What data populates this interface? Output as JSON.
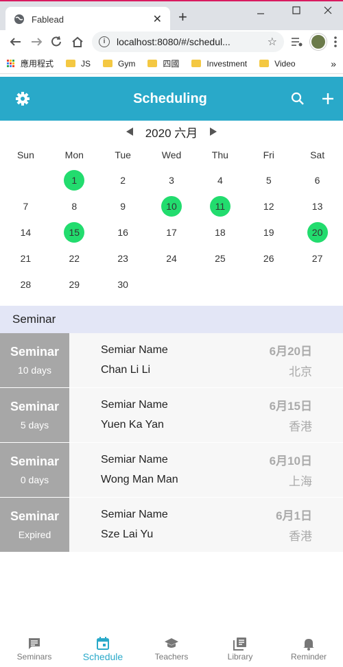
{
  "browser": {
    "tab_title": "Fablead",
    "tab_close": "✕",
    "new_tab": "+",
    "url": "localhost:8080/#/schedul...",
    "bookmarks": [
      "應用程式",
      "JS",
      "Gym",
      "四國",
      "Investment",
      "Video"
    ],
    "bookmarks_more": "»"
  },
  "appbar": {
    "title": "Scheduling",
    "settings_icon": "⚙",
    "search_icon": "⚲",
    "add_icon": "+"
  },
  "calendar": {
    "title": "2020 六月",
    "weekdays": [
      "Sun",
      "Mon",
      "Tue",
      "Wed",
      "Thu",
      "Fri",
      "Sat"
    ],
    "weeks": [
      [
        "",
        "1",
        "2",
        "3",
        "4",
        "5",
        "6"
      ],
      [
        "7",
        "8",
        "9",
        "10",
        "11",
        "12",
        "13"
      ],
      [
        "14",
        "15",
        "16",
        "17",
        "18",
        "19",
        "20"
      ],
      [
        "21",
        "22",
        "23",
        "24",
        "25",
        "26",
        "27"
      ],
      [
        "28",
        "29",
        "30",
        "",
        "",
        "",
        ""
      ]
    ],
    "marked_days": [
      "1",
      "10",
      "11",
      "15",
      "20"
    ],
    "marked_color": "#22dc6e"
  },
  "section": {
    "title": "Seminar"
  },
  "seminars": [
    {
      "badge": "Seminar",
      "days": "10 days",
      "name": "Semiar Name",
      "person": "Chan Li Li",
      "date": "6月20日",
      "place": "北京"
    },
    {
      "badge": "Seminar",
      "days": "5 days",
      "name": "Semiar Name",
      "person": "Yuen Ka Yan",
      "date": "6月15日",
      "place": "香港"
    },
    {
      "badge": "Seminar",
      "days": "0 days",
      "name": "Semiar Name",
      "person": "Wong Man Man",
      "date": "6月10日",
      "place": "上海"
    },
    {
      "badge": "Seminar",
      "days": "Expired",
      "name": "Semiar Name",
      "person": "Sze Lai Yu",
      "date": "6月1日",
      "place": "香港"
    }
  ],
  "bottom_nav": [
    {
      "label": "Seminars",
      "icon": "chat-icon",
      "active": false
    },
    {
      "label": "Schedule",
      "icon": "calendar-icon",
      "active": true
    },
    {
      "label": "Teachers",
      "icon": "school-icon",
      "active": false
    },
    {
      "label": "Library",
      "icon": "library-icon",
      "active": false
    },
    {
      "label": "Reminder",
      "icon": "bell-icon",
      "active": false
    }
  ],
  "colors": {
    "primary": "#29a9c9",
    "badge": "#a7a7a7",
    "section_bg": "#e3e6f6"
  }
}
